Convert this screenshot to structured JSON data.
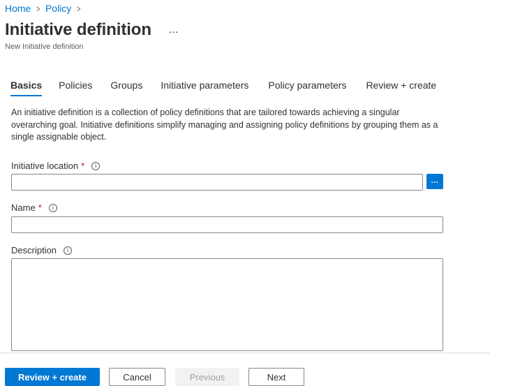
{
  "breadcrumb": {
    "items": [
      "Home",
      "Policy"
    ],
    "separator": ">"
  },
  "header": {
    "title": "Initiative definition",
    "more_icon": "…",
    "subtitle": "New Initiative definition"
  },
  "tabs": [
    {
      "label": "Basics",
      "active": true
    },
    {
      "label": "Policies",
      "active": false
    },
    {
      "label": "Groups",
      "active": false
    },
    {
      "label": "Initiative parameters",
      "active": false
    },
    {
      "label": "Policy parameters",
      "active": false
    },
    {
      "label": "Review + create",
      "active": false
    }
  ],
  "intro": "An initiative definition is a collection of policy definitions that are tailored towards achieving a singular overarching goal. Initiative definitions simplify managing and assigning policy definitions by grouping them as a single assignable object.",
  "form": {
    "location": {
      "label": "Initiative location",
      "required_mark": "*",
      "value": "",
      "browse_label": "..."
    },
    "name": {
      "label": "Name",
      "required_mark": "*",
      "value": ""
    },
    "description": {
      "label": "Description",
      "value": ""
    },
    "info_glyph": "i"
  },
  "footer": {
    "review_create": "Review + create",
    "cancel": "Cancel",
    "previous": "Previous",
    "next": "Next"
  },
  "colors": {
    "accent": "#0078d4",
    "required": "#a4262c",
    "text": "#323130"
  },
  "icons": [
    "chevron-right-icon",
    "more-icon",
    "info-icon",
    "browse-icon"
  ]
}
